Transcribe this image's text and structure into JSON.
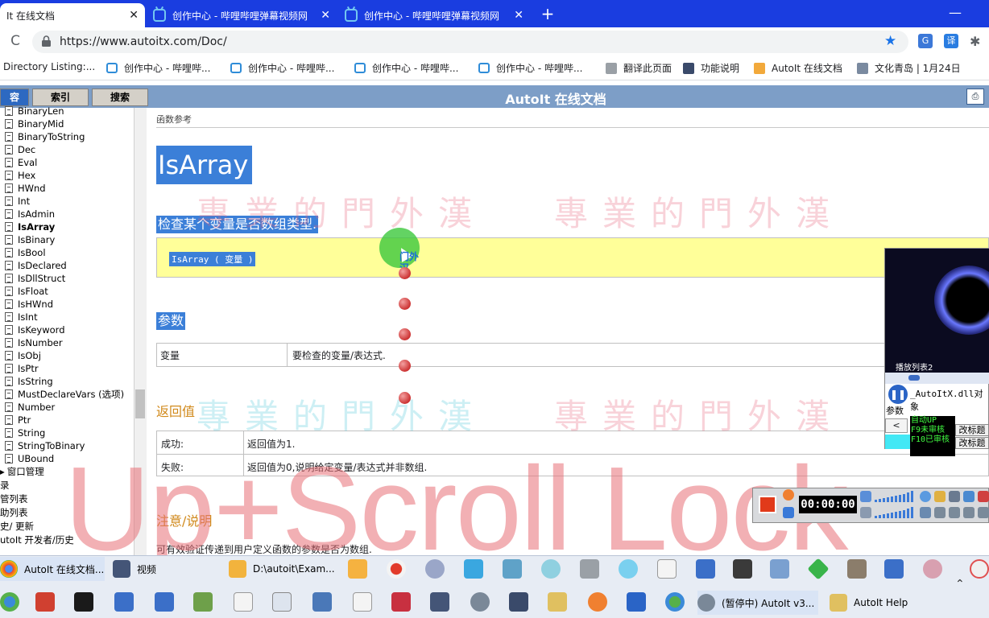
{
  "browser": {
    "tabs": [
      {
        "title": "It 在线文档",
        "active": true
      },
      {
        "title": "创作中心 - 哔哩哔哩弹幕视频网",
        "active": false
      },
      {
        "title": "创作中心 - 哔哩哔哩弹幕视频网",
        "active": false
      }
    ],
    "close_glyph": "✕",
    "new_tab_glyph": "+",
    "minimize_glyph": "—",
    "url": "https://www.autoitx.com/Doc/",
    "reload_glyph": "C",
    "star_glyph": "★",
    "ext1_label": "G",
    "ext2_label": "译",
    "ext3_glyph": "✱"
  },
  "bookmarks": [
    "Directory Listing:...",
    "创作中心 - 哔哩哔...",
    "创作中心 - 哔哩哔...",
    "创作中心 - 哔哩哔...",
    "创作中心 - 哔哩哔...",
    "翻译此页面",
    "功能说明",
    "AutoIt 在线文档",
    "文化青岛 | 1月24日"
  ],
  "help": {
    "tabs": [
      "容",
      "索引",
      "搜索"
    ],
    "title": "AutoIt 在线文档",
    "print_glyph": "⎙"
  },
  "tree": {
    "items": [
      "BinaryLen",
      "BinaryMid",
      "BinaryToString",
      "Dec",
      "Eval",
      "Hex",
      "HWnd",
      "Int",
      "IsAdmin",
      "IsArray",
      "IsBinary",
      "IsBool",
      "IsDeclared",
      "IsDllStruct",
      "IsFloat",
      "IsHWnd",
      "IsInt",
      "IsKeyword",
      "IsNumber",
      "IsObj",
      "IsPtr",
      "IsString",
      "MustDeclareVars (选项)",
      "Number",
      "Ptr",
      "String",
      "StringToBinary",
      "UBound"
    ],
    "selected": "IsArray",
    "folders": [
      "窗口管理",
      "录",
      "管列表",
      "助列表",
      "史/ 更新",
      "utoIt 开发者/历史"
    ],
    "folder_glyph": "▸"
  },
  "page": {
    "breadcrumb": "函数参考",
    "function_name": "IsArray",
    "description": "检查某个变量是否数组类型.",
    "syntax": "IsArray ( 变量 )",
    "params_heading": "参数",
    "param_name": "变量",
    "param_desc": "要检查的变量/表达式.",
    "return_heading": "返回值",
    "returns": [
      {
        "key": "成功:",
        "value": "返回值为1."
      },
      {
        "key": "失败:",
        "value": "返回值为0,说明给定变量/表达式并非数组."
      }
    ],
    "notes_heading": "注意/说明",
    "notes_text": "可有效验证传递到用户定义函数的参数是否为数组."
  },
  "overlay": {
    "watermark": "專業的門外漢",
    "key_display": "Up+Scroll Lock",
    "cursor_label": "门外汉"
  },
  "player": {
    "playlist_label": "播放列表2",
    "file": "_AutoItX.dll对象",
    "param_label": "参数",
    "back_glyph": "<",
    "pause_glyph": "❚❚",
    "status_lines": [
      "自动UP",
      "F9未审核",
      "F10已审核"
    ],
    "rename_label_1": "改标题",
    "rename_label_2": "改标题"
  },
  "recorder": {
    "time": "00:00:00"
  },
  "taskbar": {
    "row1": [
      {
        "label": "AutoIt 在线文档..."
      },
      {
        "label": "视频"
      },
      {
        "label": "D:\\autoit\\Exam..."
      }
    ],
    "row2": [
      {
        "label": "(暂停中) AutoIt v3..."
      },
      {
        "label": "AutoIt Help"
      }
    ],
    "chevron_glyph": "⌃"
  },
  "colors": {
    "chrome_tabbar": "#1a3de0",
    "help_header": "#7d9ec7",
    "highlight": "#3b7fd8",
    "syntax_box": "#ffff99",
    "section_orange": "#d18a1c"
  }
}
